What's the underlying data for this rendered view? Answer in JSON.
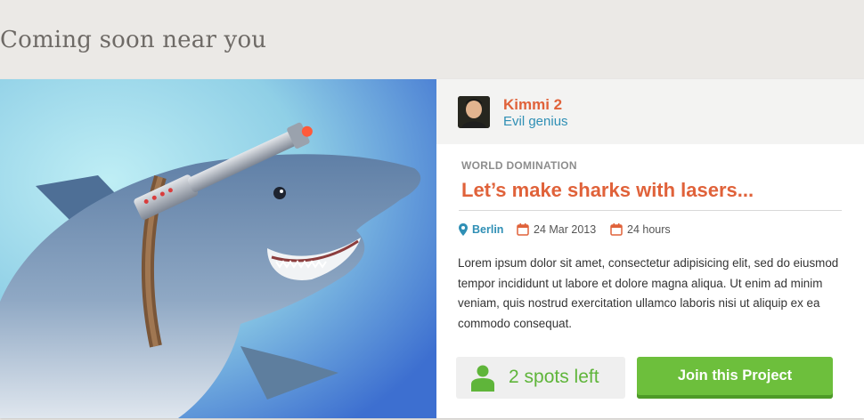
{
  "section": {
    "title": "Coming soon near you"
  },
  "hero": {
    "image_subject": "laser-shark-illustration"
  },
  "owner": {
    "name": "Kimmi 2",
    "role": "Evil genius",
    "avatar_icon": "person-avatar"
  },
  "project": {
    "category": "WORLD DOMINATION",
    "title": "Let’s make sharks with lasers...",
    "location": "Berlin",
    "date": "24 Mar 2013",
    "duration": "24 hours",
    "description": "Lorem ipsum dolor sit amet, consectetur adipisicing elit, sed do eiusmod tempor incididunt ut labore et dolore magna aliqua. Ut enim ad minim veniam, quis nostrud exercitation ullamco laboris nisi ut aliquip ex ea commodo consequat."
  },
  "spots": {
    "label": "2 spots left"
  },
  "actions": {
    "join_label": "Join this Project"
  },
  "colors": {
    "accent_orange": "#e0623a",
    "accent_blue": "#2f8fb5",
    "accent_green": "#6dbf3c"
  }
}
